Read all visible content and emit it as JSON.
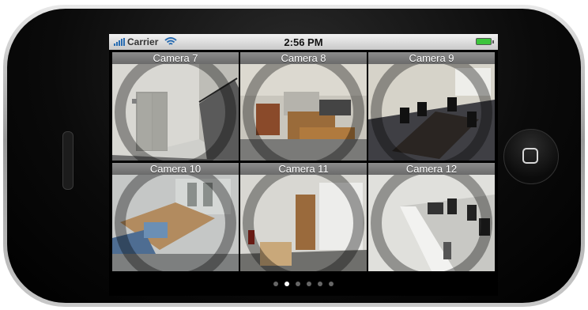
{
  "status_bar": {
    "carrier": "Carrier",
    "time": "2:56 PM",
    "icons": [
      "signal-bars-icon",
      "wifi-icon",
      "battery-icon"
    ]
  },
  "cameras": [
    {
      "label": "Camera 7"
    },
    {
      "label": "Camera 8"
    },
    {
      "label": "Camera 9"
    },
    {
      "label": "Camera 10"
    },
    {
      "label": "Camera 11"
    },
    {
      "label": "Camera 12"
    }
  ],
  "pagination": {
    "page_count": 6,
    "active_page": 2
  },
  "colors": {
    "battery": "#3cc43c",
    "signal": "#2a6db2"
  }
}
